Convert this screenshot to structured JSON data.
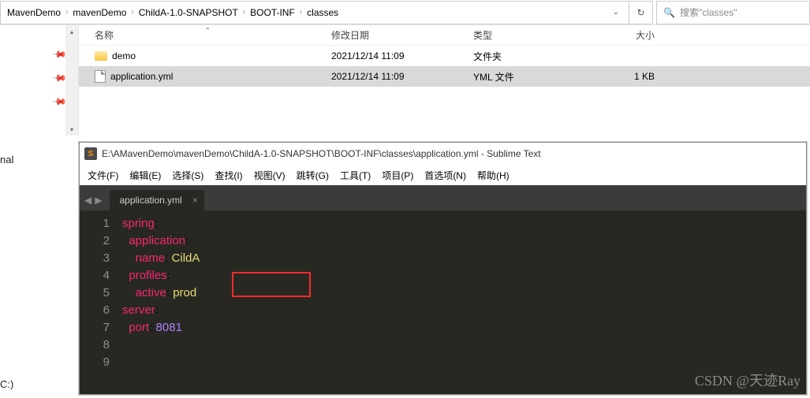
{
  "breadcrumb": {
    "items": [
      "MavenDemo",
      "mavenDemo",
      "ChildA-1.0-SNAPSHOT",
      "BOOT-INF",
      "classes"
    ]
  },
  "search": {
    "placeholder": "搜索\"classes\""
  },
  "columns": {
    "name": "名称",
    "date": "修改日期",
    "type": "类型",
    "size": "大小"
  },
  "files": [
    {
      "name": "demo",
      "date": "2021/12/14 11:09",
      "type": "文件夹",
      "size": ""
    },
    {
      "name": "application.yml",
      "date": "2021/12/14 11:09",
      "type": "YML 文件",
      "size": "1 KB"
    }
  ],
  "side": {
    "nal": "nal",
    "c": "C:)"
  },
  "sublime": {
    "title": "E:\\AMavenDemo\\mavenDemo\\ChildA-1.0-SNAPSHOT\\BOOT-INF\\classes\\application.yml - Sublime Text",
    "menu": [
      "文件(F)",
      "编辑(E)",
      "选择(S)",
      "查找(I)",
      "视图(V)",
      "跳转(G)",
      "工具(T)",
      "项目(P)",
      "首选项(N)",
      "帮助(H)"
    ],
    "tab": "application.yml",
    "lines": [
      "1",
      "2",
      "3",
      "4",
      "5",
      "6",
      "7",
      "8",
      "9"
    ],
    "code": {
      "l1k": "spring",
      "l1c": ":",
      "l2k": "application",
      "l2c": ":",
      "l3k": "name",
      "l3c": ": ",
      "l3v": "CildA",
      "l4k": "profiles",
      "l4c": ":",
      "l5k": "active",
      "l5c": ": ",
      "l5v": "prod",
      "l6k": "server",
      "l6c": ":",
      "l7k": "port",
      "l7c": ": ",
      "l7v": "8081"
    }
  },
  "watermark": "CSDN @天迹Ray"
}
